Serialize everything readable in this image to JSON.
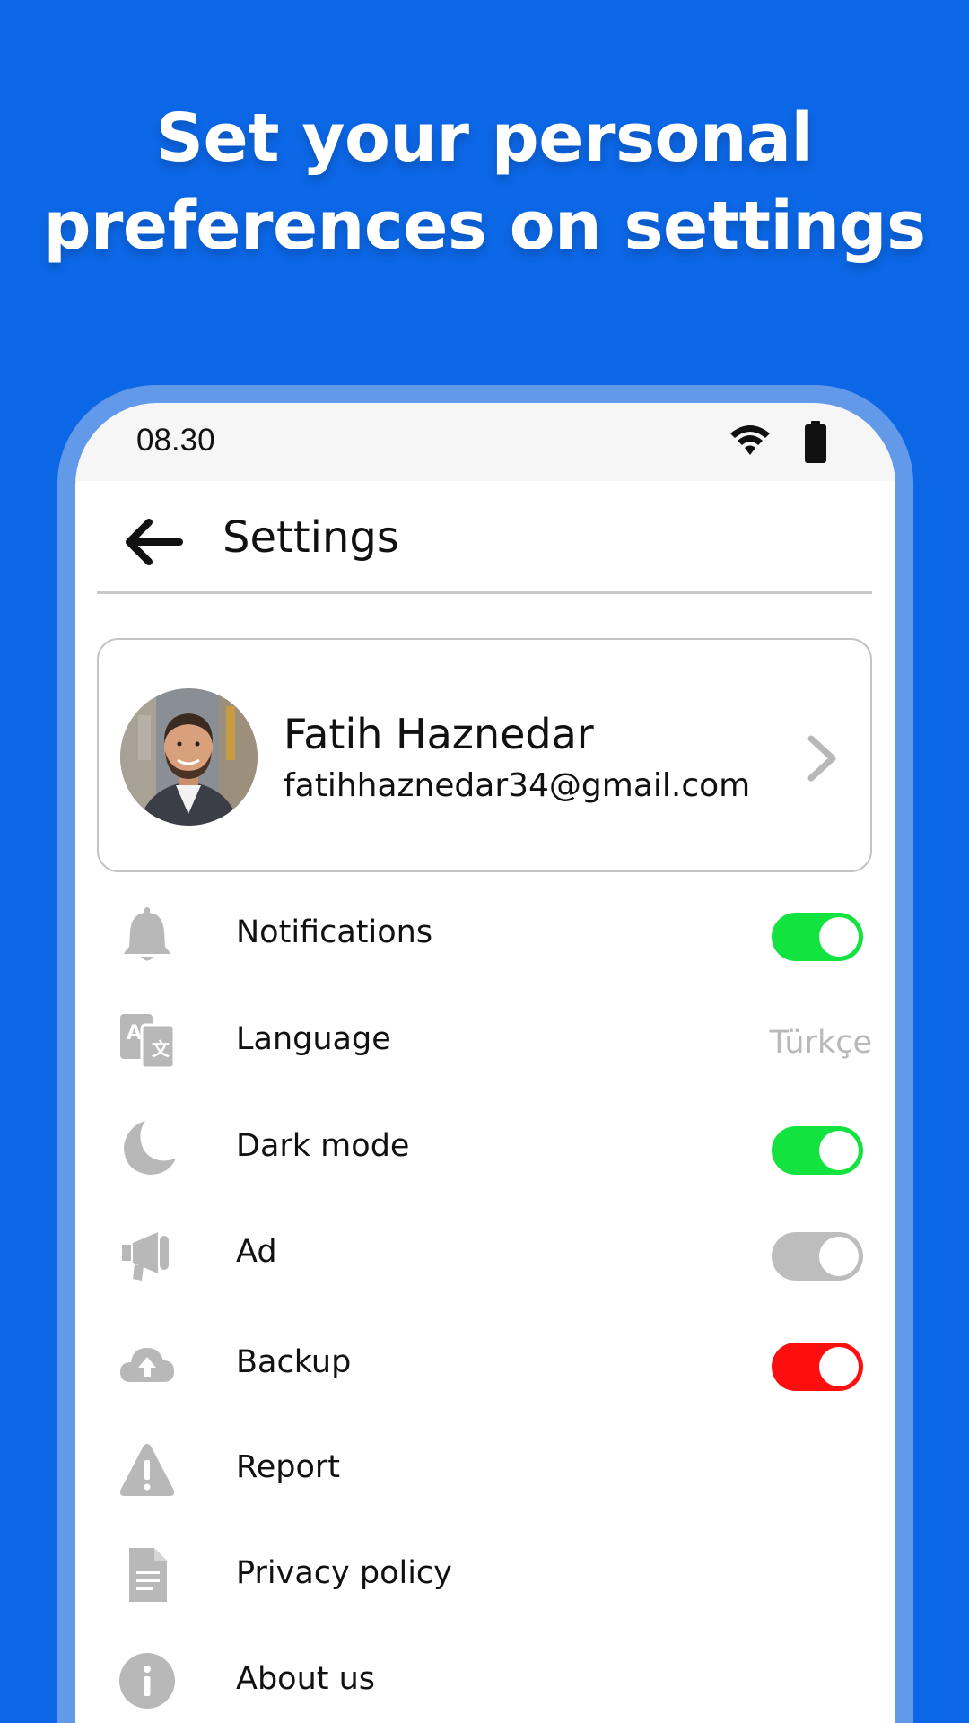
{
  "headline": {
    "line1": "Set your personal",
    "line2": "preferences on settings"
  },
  "status_bar": {
    "time": "08.30",
    "icons": [
      "wifi-icon",
      "battery-icon"
    ]
  },
  "app_bar": {
    "title": "Settings",
    "back_icon": "arrow-left-icon"
  },
  "profile": {
    "name": "Fatih Haznedar",
    "email": "fatihhaznedar34@gmail.com"
  },
  "settings": [
    {
      "label": "Notifications",
      "icon": "bell-icon",
      "control": "toggle",
      "state": "on",
      "color": "#12e33f"
    },
    {
      "label": "Language",
      "icon": "translate-icon",
      "control": "value",
      "value": "Türkçe"
    },
    {
      "label": "Dark mode",
      "icon": "moon-icon",
      "control": "toggle",
      "state": "on",
      "color": "#12e33f"
    },
    {
      "label": "Ad",
      "icon": "megaphone-icon",
      "control": "toggle",
      "state": "off",
      "color": "#bdbdbd"
    },
    {
      "label": "Backup",
      "icon": "cloud-upload-icon",
      "control": "toggle",
      "state": "on",
      "color": "#ff0e10"
    },
    {
      "label": "Report",
      "icon": "warning-icon",
      "control": "none"
    },
    {
      "label": "Privacy policy",
      "icon": "document-icon",
      "control": "none"
    },
    {
      "label": "About us",
      "icon": "info-icon",
      "control": "none"
    }
  ],
  "colors": {
    "background": "#0c67e6",
    "phone_frame": "#6299e8",
    "toggle_on": "#12e33f",
    "toggle_off": "#bdbdbd",
    "toggle_red": "#ff0e10",
    "icon_gray": "#b8b8b8"
  }
}
